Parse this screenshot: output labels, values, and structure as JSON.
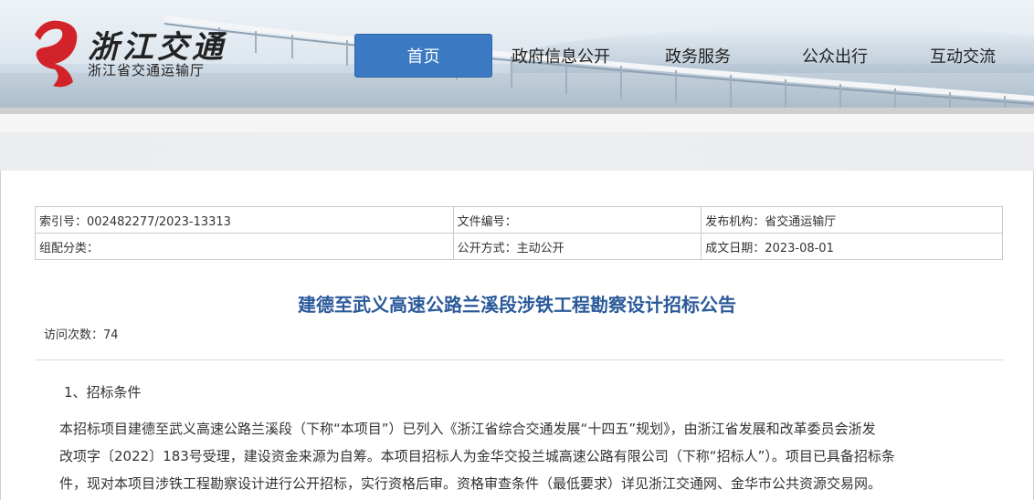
{
  "header": {
    "logo_title": "浙江交通",
    "logo_subtitle": "浙江省交通运输厅"
  },
  "nav": [
    {
      "label": "首页",
      "active": true
    },
    {
      "label": "政府信息公开",
      "active": false
    },
    {
      "label": "政务服务",
      "active": false
    },
    {
      "label": "公众出行",
      "active": false
    },
    {
      "label": "互动交流",
      "active": false
    }
  ],
  "info": {
    "index_no": "索引号：002482277/2023-13313",
    "doc_no": "文件编号：",
    "publisher": "发布机构：省交通运输厅",
    "category": "组配分类：",
    "open_mode": "公开方式：主动公开",
    "date": "成文日期：2023-08-01"
  },
  "article": {
    "title": "建德至武义高速公路兰溪段涉铁工程勘察设计招标公告",
    "visits": "访问次数：74",
    "section1": "1、招标条件",
    "para_lines": [
      "本招标项目建德至武义高速公路兰溪段（下称“本项目”）已列入《浙江省综合交通发展“十四五”规划》，由浙江省发展和改革委员会浙发",
      "改项字〔2022〕183号受理，建设资金来源为自筹。本项目招标人为金华交投兰城高速公路有限公司（下称“招标人”）。项目已具备招标条",
      "件，现对本项目涉铁工程勘察设计进行公开招标，实行资格后审。资格审查条件（最低要求）详见浙江交通网、金华市公共资源交易网。"
    ]
  },
  "colors": {
    "nav_active": "#3b79c2",
    "title": "#2b5a9a",
    "logo_red": "#d2232a"
  }
}
